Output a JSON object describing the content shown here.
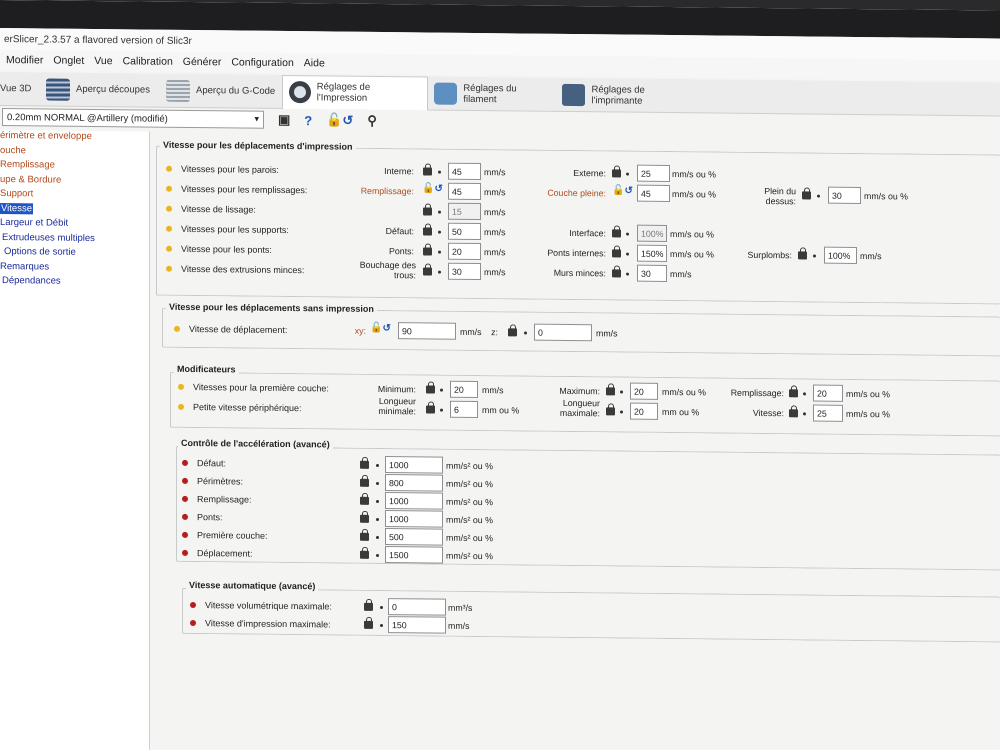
{
  "window": {
    "title": "erSlicer_2.3.57 a flavored version of Slic3r"
  },
  "menu": [
    "Modifier",
    "Onglet",
    "Vue",
    "Calibration",
    "Générer",
    "Configuration",
    "Aide"
  ],
  "tabs": [
    {
      "label": "Vue 3D",
      "icon": "cube-icon"
    },
    {
      "label": "Aperçu découpes",
      "icon": "layers-icon"
    },
    {
      "label": "Aperçu du G-Code",
      "icon": "gcode-icon"
    },
    {
      "label": "Réglages de l'Impression",
      "icon": "gear-icon",
      "active": true
    },
    {
      "label": "Réglages du filament",
      "icon": "filament-icon"
    },
    {
      "label": "Réglages de l'imprimante",
      "icon": "printer-icon"
    }
  ],
  "toolbar": {
    "preset": "0.20mm NORMAL @Artillery (modifié)",
    "save_icon": "save-icon",
    "help": "?",
    "compare_icon": "compare-icon",
    "search_icon": "search-icon"
  },
  "sidebar": [
    "érimètre et enveloppe",
    "ouche",
    "Remplissage",
    "upe & Bordure",
    "Support",
    "Vitesse",
    "Largeur et Débit",
    "Extrudeuses multiples",
    "Options de sortie",
    "Remarques",
    "Dépendances"
  ],
  "speed": {
    "title": "Vitesse pour les déplacements d'impression",
    "rows": [
      {
        "label": "Vitesses pour les parois:",
        "c1": {
          "label": "Interne:",
          "value": "45",
          "unit": "mm/s"
        },
        "c2": {
          "label": "Externe:",
          "value": "25",
          "unit": "mm/s ou %"
        }
      },
      {
        "label": "Vitesses pour les remplissages:",
        "c1": {
          "label": "Remplissage:",
          "value": "45",
          "unit": "mm/s"
        },
        "c2": {
          "label": "Couche pleine:",
          "value": "45",
          "unit": "mm/s ou %"
        },
        "c3": {
          "label": "Plein du dessus:",
          "value": "30",
          "unit": "mm/s ou %"
        }
      },
      {
        "label": "Vitesse de lissage:",
        "c1": {
          "label": "",
          "value": "15",
          "unit": "mm/s"
        }
      },
      {
        "label": "Vitesses pour les supports:",
        "c1": {
          "label": "Défaut:",
          "value": "50",
          "unit": "mm/s"
        },
        "c2": {
          "label": "Interface:",
          "value": "100%",
          "unit": "mm/s ou %"
        }
      },
      {
        "label": "Vitesse pour les ponts:",
        "c1": {
          "label": "Ponts:",
          "value": "20",
          "unit": "mm/s"
        },
        "c2": {
          "label": "Ponts internes:",
          "value": "150%",
          "unit": "mm/s ou %"
        },
        "c3": {
          "label": "Surplombs:",
          "value": "100%",
          "unit": "mm/s"
        }
      },
      {
        "label": "Vitesse des extrusions minces:",
        "c1": {
          "label": "Bouchage des trous:",
          "value": "30",
          "unit": "mm/s"
        },
        "c2": {
          "label": "Murs minces:",
          "value": "30",
          "unit": "mm/s"
        }
      }
    ]
  },
  "travel": {
    "title": "Vitesse pour les déplacements sans impression",
    "label": "Vitesse de déplacement:",
    "xy": {
      "label": "xy:",
      "value": "90",
      "unit": "mm/s"
    },
    "z": {
      "label": "z:",
      "value": "0",
      "unit": "mm/s"
    }
  },
  "modifiers": {
    "title": "Modificateurs",
    "rows": [
      {
        "label": "Vitesses pour la première couche:",
        "c1": {
          "label": "Minimum:",
          "value": "20",
          "unit": "mm/s"
        },
        "c2": {
          "label": "Maximum:",
          "value": "20",
          "unit": "mm/s ou %"
        },
        "c3": {
          "label": "Remplissage:",
          "value": "20",
          "unit": "mm/s ou %"
        }
      },
      {
        "label": "Petite vitesse périphérique:",
        "c1": {
          "label": "Longueur minimale:",
          "value": "6",
          "unit": "mm ou %"
        },
        "c2": {
          "label": "Longueur maximale:",
          "value": "20",
          "unit": "mm ou %"
        },
        "c3": {
          "label": "Vitesse:",
          "value": "25",
          "unit": "mm/s ou %"
        }
      }
    ]
  },
  "acceleration": {
    "title": "Contrôle de l'accélération (avancé)",
    "rows": [
      {
        "label": "Défaut:",
        "value": "1000",
        "unit": "mm/s² ou %"
      },
      {
        "label": "Périmètres:",
        "value": "800",
        "unit": "mm/s² ou %"
      },
      {
        "label": "Remplissage:",
        "value": "1000",
        "unit": "mm/s² ou %"
      },
      {
        "label": "Ponts:",
        "value": "1000",
        "unit": "mm/s² ou %"
      },
      {
        "label": "Première couche:",
        "value": "500",
        "unit": "mm/s² ou %"
      },
      {
        "label": "Déplacement:",
        "value": "1500",
        "unit": "mm/s² ou %"
      }
    ]
  },
  "auto": {
    "title": "Vitesse automatique (avancé)",
    "rows": [
      {
        "label": "Vitesse volumétrique maximale:",
        "value": "0",
        "unit": "mm³/s"
      },
      {
        "label": "Vitesse d'impression maximale:",
        "value": "150",
        "unit": "mm/s"
      }
    ]
  },
  "colors": {
    "simple": "#e8b622",
    "expert": "#b51e1e",
    "accent": "#1e54c8",
    "modified": "#b14b1e"
  }
}
